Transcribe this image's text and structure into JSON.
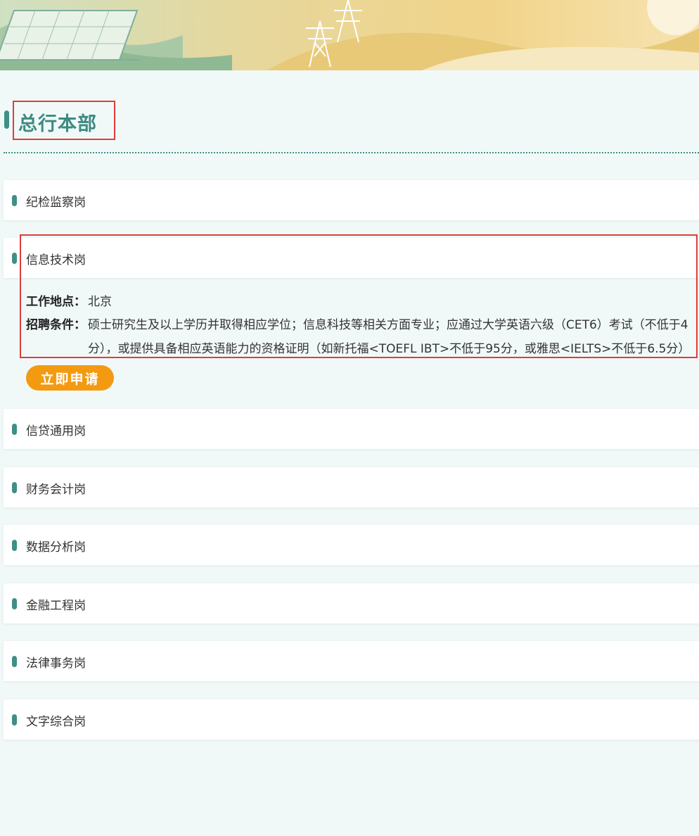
{
  "section": {
    "title": "总行本部"
  },
  "jobs": [
    {
      "label": "纪检监察岗"
    },
    {
      "label": "信息技术岗"
    },
    {
      "label": "信贷通用岗"
    },
    {
      "label": "财务会计岗"
    },
    {
      "label": "数据分析岗"
    },
    {
      "label": "金融工程岗"
    },
    {
      "label": "法律事务岗"
    },
    {
      "label": "文字综合岗"
    }
  ],
  "detail": {
    "location_key": "工作地点：",
    "location_val": "北京",
    "req_key": "招聘条件：",
    "req_line1": "硕士研究生及以上学历并取得相应学位；信息科技等相关方面专业；应通过大学英语六级（CET6）考试（不低于4",
    "req_line2": "分），或提供具备相应英语能力的资格证明（如新托福<TOEFL IBT>不低于95分，或雅思<IELTS>不低于6.5分）"
  },
  "apply_label": "立即申请",
  "colors": {
    "accent": "#3f8f86",
    "button": "#f39a11",
    "highlight": "#e03c3c",
    "background": "#f1f9f8"
  }
}
